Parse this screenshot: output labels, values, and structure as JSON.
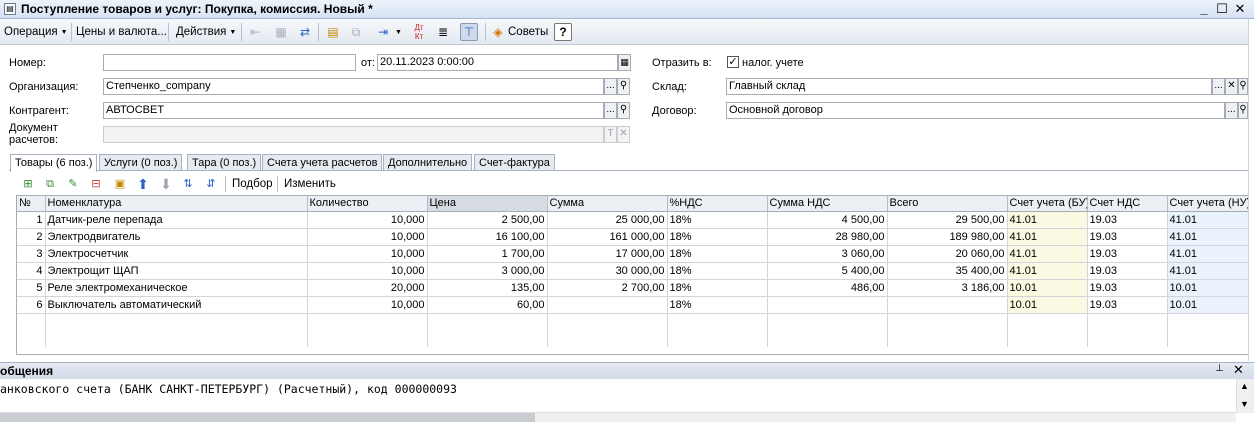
{
  "window": {
    "title": "Поступление товаров и услуг: Покупка, комиссия. Новый *",
    "icon": "document-icon",
    "minimize": "_",
    "maximize": "☐",
    "close": "✕"
  },
  "toolbar": {
    "operation": "Операция",
    "prices": "Цены и валюта...",
    "actions": "Действия",
    "tips": "Советы",
    "help": "?"
  },
  "form": {
    "number_label": "Номер:",
    "number_value": "",
    "date_label": "от:",
    "date_value": "20.11.2023  0:00:00",
    "reflect_label": "Отразить в:",
    "tax_accounting_label": "налог. учете",
    "tax_accounting_checked": true,
    "org_label": "Организация:",
    "org_value": "Степченко_company",
    "warehouse_label": "Склад:",
    "warehouse_value": "Главный склад",
    "counterparty_label": "Контрагент:",
    "counterparty_value": "АВТОСВЕТ",
    "contract_label": "Договор:",
    "contract_value": "Основной договор",
    "settlement_doc_label_1": "Документ",
    "settlement_doc_label_2": "расчетов:",
    "settlement_doc_value": "",
    "select_btn": "...",
    "open_btn": "🔍",
    "clear_btn": "✕",
    "type_btn": "T"
  },
  "tabs": [
    {
      "label": "Товары (6 поз.)",
      "active": true
    },
    {
      "label": "Услуги (0 поз.)",
      "active": false
    },
    {
      "label": "Тара (0 поз.)",
      "active": false
    },
    {
      "label": "Счета учета расчетов",
      "active": false
    },
    {
      "label": "Дополнительно",
      "active": false
    },
    {
      "label": "Счет-фактура",
      "active": false
    }
  ],
  "grid_toolbar": {
    "pick": "Подбор",
    "edit": "Изменить"
  },
  "grid": {
    "columns": [
      "№",
      "Номенклатура",
      "Количество",
      "Цена",
      "Сумма",
      "%НДС",
      "Сумма НДС",
      "Всего",
      "Счет учета (БУ)",
      "Счет НДС",
      "Счет учета (НУ)"
    ],
    "rows": [
      [
        "1",
        "Датчик-реле перепада",
        "10,000",
        "2 500,00",
        "25 000,00",
        "18%",
        "4 500,00",
        "29 500,00",
        "41.01",
        "19.03",
        "41.01"
      ],
      [
        "2",
        "Электродвигатель",
        "10,000",
        "16 100,00",
        "161 000,00",
        "18%",
        "28 980,00",
        "189 980,00",
        "41.01",
        "19.03",
        "41.01"
      ],
      [
        "3",
        "Электросчетчик",
        "10,000",
        "1 700,00",
        "17 000,00",
        "18%",
        "3 060,00",
        "20 060,00",
        "41.01",
        "19.03",
        "41.01"
      ],
      [
        "4",
        "Электрощит ЩАП",
        "10,000",
        "3 000,00",
        "30 000,00",
        "18%",
        "5 400,00",
        "35 400,00",
        "41.01",
        "19.03",
        "41.01"
      ],
      [
        "5",
        "Реле электромеханическое",
        "20,000",
        "135,00",
        "2 700,00",
        "18%",
        "486,00",
        "3 186,00",
        "10.01",
        "19.03",
        "10.01"
      ],
      [
        "6",
        "Выключатель автоматический",
        "10,000",
        "60,00",
        "",
        "18%",
        "",
        "",
        "10.01",
        "19.03",
        "10.01"
      ]
    ]
  },
  "messages": {
    "title": "общения",
    "text": "анковского счета (БАНК САНКТ-ПЕТЕРБУРГ)  (Расчетный), код 000000093",
    "pin": "⊥",
    "close": "✕"
  }
}
